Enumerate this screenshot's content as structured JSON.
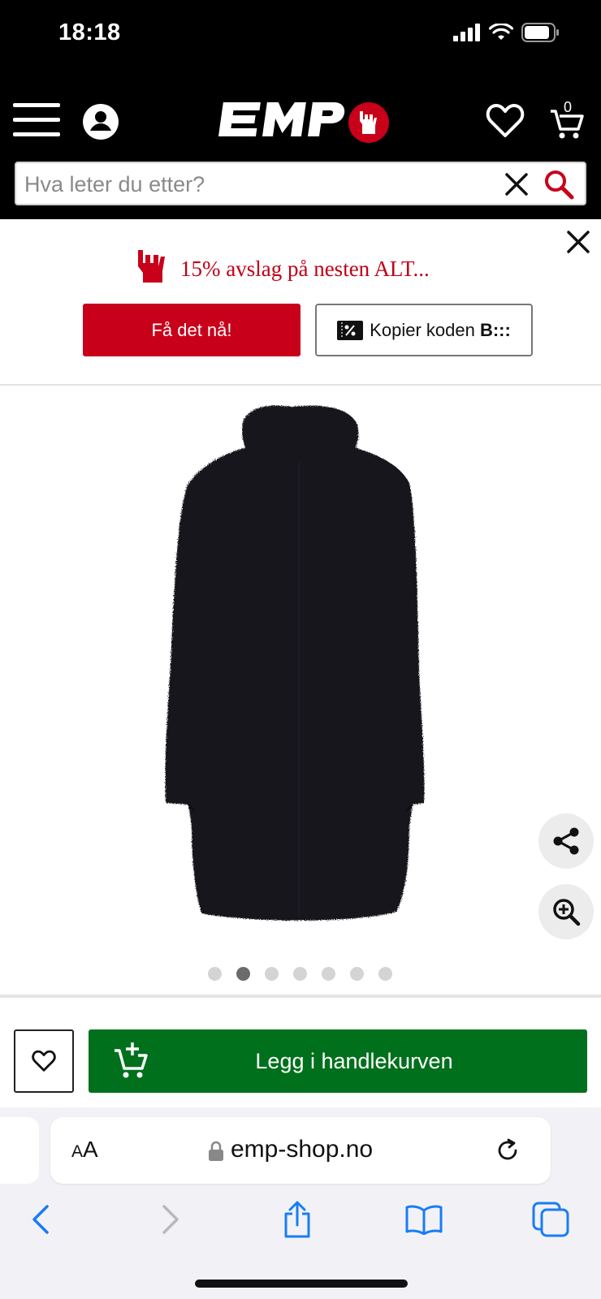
{
  "status": {
    "time": "18:18"
  },
  "header": {
    "cart_count": "0",
    "logo_text": "EMP"
  },
  "search": {
    "placeholder": "Hva leter du etter?"
  },
  "promo": {
    "text": "15% avslag på nesten ALT...",
    "primary_button": "Få det nå!",
    "copy_button_prefix": "Kopier koden ",
    "copy_button_code": "B:::"
  },
  "gallery": {
    "dot_count": 7,
    "active_index": 1
  },
  "cart": {
    "add_label": "Legg i handlekurven"
  },
  "browser": {
    "aa_small": "A",
    "aa_large": "A",
    "url": "emp-shop.no"
  },
  "colors": {
    "brand_red": "#c8001a",
    "cart_green": "#00701c",
    "ios_blue": "#1a7cf5"
  }
}
